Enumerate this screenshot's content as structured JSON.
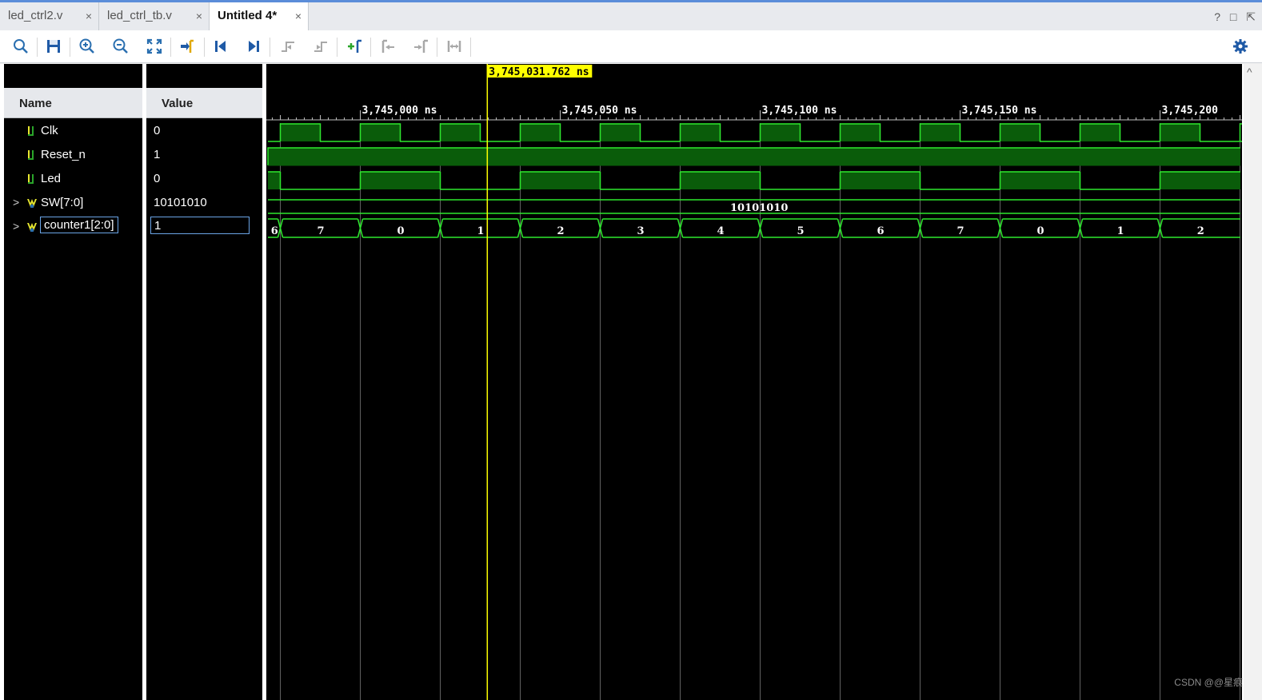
{
  "tabs": [
    {
      "label": "led_ctrl2.v",
      "close": "×",
      "active": false
    },
    {
      "label": "led_ctrl_tb.v",
      "close": "×",
      "active": false
    },
    {
      "label": "Untitled 4*",
      "close": "×",
      "active": true
    }
  ],
  "window_controls": {
    "help": "?",
    "restore": "□",
    "maximize": "⇱"
  },
  "toolbar": [
    "search-icon",
    "save-icon",
    "zoom-in-icon",
    "zoom-out-icon",
    "zoom-fit-icon",
    "go-to-cursor-icon",
    "go-to-time-zero-icon",
    "go-to-last-time-icon",
    "previous-transition-icon",
    "next-transition-icon",
    "add-marker-icon",
    "previous-marker-icon",
    "next-marker-icon",
    "swap-cursors-icon",
    "settings-gear-icon"
  ],
  "headers": {
    "name": "Name",
    "value": "Value"
  },
  "signals": [
    {
      "name": "Clk",
      "value": "0",
      "type": "bit",
      "expandable": false
    },
    {
      "name": "Reset_n",
      "value": "1",
      "type": "bit",
      "expandable": false
    },
    {
      "name": "Led",
      "value": "0",
      "type": "bit",
      "expandable": false
    },
    {
      "name": "SW[7:0]",
      "value": "10101010",
      "type": "bus",
      "expandable": true,
      "expander": ">"
    },
    {
      "name": "counter1[2:0]",
      "value": "1",
      "type": "bus",
      "expandable": true,
      "expander": ">",
      "selected": true
    }
  ],
  "cursor": {
    "label": "3,745,031.762 ns",
    "time_ns": 3745031.762
  },
  "time_axis": {
    "ticks": [
      {
        "label": "3,745,000 ns",
        "time_ns": 3745000
      },
      {
        "label": "3,745,050 ns",
        "time_ns": 3745050
      },
      {
        "label": "3,745,100 ns",
        "time_ns": 3745100
      },
      {
        "label": "3,745,150 ns",
        "time_ns": 3745150
      },
      {
        "label": "3,745,200",
        "time_ns": 3745200
      }
    ],
    "view_start_ns": 3744976.5,
    "view_end_ns": 3745220.5
  },
  "waveforms": {
    "clk_period_ns": 20,
    "clk_first_rise_ns": 3744980,
    "reset_n": "1",
    "led_segments": [
      {
        "from_ns": 3744960,
        "to_ns": 3744980,
        "level": "1"
      },
      {
        "from_ns": 3744980,
        "to_ns": 3745000,
        "level": "0"
      },
      {
        "from_ns": 3745000,
        "to_ns": 3745020,
        "level": "1"
      },
      {
        "from_ns": 3745020,
        "to_ns": 3745040,
        "level": "0"
      },
      {
        "from_ns": 3745040,
        "to_ns": 3745060,
        "level": "1"
      },
      {
        "from_ns": 3745060,
        "to_ns": 3745080,
        "level": "0"
      },
      {
        "from_ns": 3745080,
        "to_ns": 3745100,
        "level": "1"
      },
      {
        "from_ns": 3745100,
        "to_ns": 3745120,
        "level": "0"
      },
      {
        "from_ns": 3745120,
        "to_ns": 3745140,
        "level": "1"
      },
      {
        "from_ns": 3745140,
        "to_ns": 3745160,
        "level": "0"
      },
      {
        "from_ns": 3745160,
        "to_ns": 3745180,
        "level": "1"
      },
      {
        "from_ns": 3745180,
        "to_ns": 3745200,
        "level": "0"
      },
      {
        "from_ns": 3745200,
        "to_ns": 3745240,
        "level": "1"
      }
    ],
    "sw_value": "10101010",
    "counter1_segments": [
      {
        "from_ns": 3744960,
        "to_ns": 3744980,
        "value": "6"
      },
      {
        "from_ns": 3744980,
        "to_ns": 3745000,
        "value": "7"
      },
      {
        "from_ns": 3745000,
        "to_ns": 3745020,
        "value": "0"
      },
      {
        "from_ns": 3745020,
        "to_ns": 3745040,
        "value": "1"
      },
      {
        "from_ns": 3745040,
        "to_ns": 3745060,
        "value": "2"
      },
      {
        "from_ns": 3745060,
        "to_ns": 3745080,
        "value": "3"
      },
      {
        "from_ns": 3745080,
        "to_ns": 3745100,
        "value": "4"
      },
      {
        "from_ns": 3745100,
        "to_ns": 3745120,
        "value": "5"
      },
      {
        "from_ns": 3745120,
        "to_ns": 3745140,
        "value": "6"
      },
      {
        "from_ns": 3745140,
        "to_ns": 3745160,
        "value": "7"
      },
      {
        "from_ns": 3745160,
        "to_ns": 3745180,
        "value": "0"
      },
      {
        "from_ns": 3745180,
        "to_ns": 3745200,
        "value": "1"
      },
      {
        "from_ns": 3745200,
        "to_ns": 3745240,
        "value": "2"
      }
    ]
  },
  "colors": {
    "wave_green": "#2ee82e",
    "wave_fill": "#0a5c0a",
    "cursor_yellow": "#ffff00",
    "background": "#000000",
    "selection_border": "#6aa4e6"
  },
  "scrollbar": {
    "up": "^"
  },
  "watermark": "CSDN @@星痕"
}
